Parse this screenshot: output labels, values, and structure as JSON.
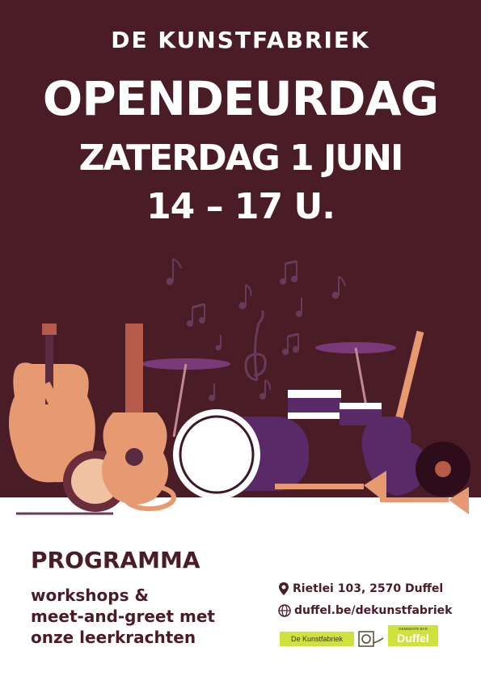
{
  "header": {
    "organization": "DE KUNSTFABRIEK",
    "title": "OPENDEURDAG",
    "date": "ZATERDAG 1 JUNI",
    "time": "14 – 17 U."
  },
  "programma": {
    "heading": "PROGRAMMA",
    "lines": [
      "workshops &",
      "meet-and-greet met",
      "onze leerkrachten"
    ]
  },
  "contact": {
    "address": "Rietlei 103, 2570 Duffel",
    "website": "duffel.be/dekunstfabriek"
  },
  "logos": {
    "kunstfabriek": "De Kunstfabriek",
    "gemeente_small": "GEMEENTE BAR",
    "gemeente": "Duffel"
  },
  "colors": {
    "background_dark": "#4a1d26",
    "accent_orange": "#e79a72",
    "accent_purple": "#5a2a68",
    "logo_green": "#cfe13d"
  },
  "icons": [
    "location-pin-icon",
    "globe-icon",
    "music-note-icon",
    "treble-clef-icon"
  ]
}
